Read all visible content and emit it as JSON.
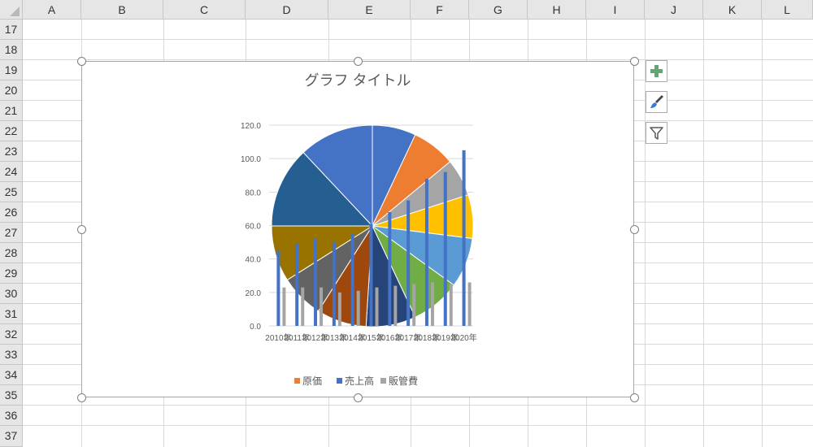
{
  "spreadsheet": {
    "columns": [
      "A",
      "B",
      "C",
      "D",
      "E",
      "F",
      "G",
      "H",
      "I",
      "J",
      "K",
      "L"
    ],
    "rows": [
      "17",
      "18",
      "19",
      "20",
      "21",
      "22",
      "23",
      "24",
      "25",
      "26",
      "27",
      "28",
      "29",
      "30",
      "31",
      "32",
      "33",
      "34",
      "35",
      "36",
      "37"
    ]
  },
  "chart_tools": [
    {
      "name": "add-chart-element-button",
      "icon": "plus-icon"
    },
    {
      "name": "chart-styles-button",
      "icon": "paintbrush-icon"
    },
    {
      "name": "chart-filters-button",
      "icon": "filter-icon"
    }
  ],
  "chart_data": {
    "type": "bar",
    "title": "グラフ タイトル",
    "categories": [
      "2010年",
      "2011年",
      "2012年",
      "2013年",
      "2014年",
      "2015年",
      "2016年",
      "2017年",
      "2018年",
      "2019年",
      "2020年"
    ],
    "yticks": [
      "0.0",
      "20.0",
      "40.0",
      "60.0",
      "80.0",
      "100.0",
      "120.0"
    ],
    "ylim": [
      0,
      120
    ],
    "grid": true,
    "legend_position": "bottom",
    "series": [
      {
        "name": "原価",
        "color": "#ed7d31",
        "values": [
          0,
          0,
          0,
          0,
          0,
          0,
          0,
          0,
          0,
          0,
          0
        ]
      },
      {
        "name": "売上高",
        "color": "#4472c4",
        "values": [
          45,
          49,
          52,
          50,
          55,
          61,
          68,
          75,
          88,
          92,
          105
        ]
      },
      {
        "name": "販管費",
        "color": "#a5a5a5",
        "values": [
          23,
          23,
          23,
          20,
          21,
          23,
          24,
          25,
          26,
          25,
          26
        ]
      }
    ],
    "pie_overlay": {
      "values": [
        7,
        7,
        6,
        7,
        8,
        8,
        8,
        8,
        7,
        9,
        13,
        12
      ],
      "colors": [
        "#4472c4",
        "#ed7d31",
        "#a5a5a5",
        "#ffc000",
        "#5b9bd5",
        "#70ad47",
        "#264478",
        "#9e480e",
        "#636363",
        "#997300",
        "#255e91",
        "#4472c4"
      ]
    }
  }
}
